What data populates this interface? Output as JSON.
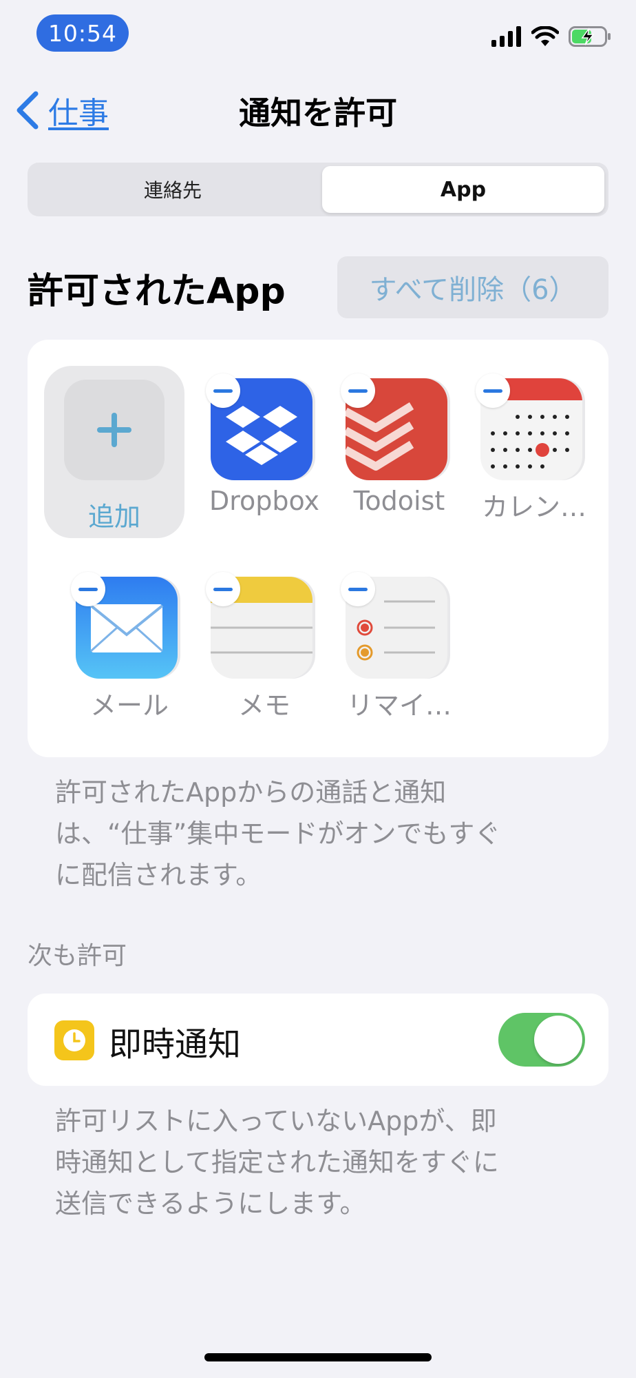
{
  "status_bar": {
    "time": "10:54"
  },
  "nav": {
    "back_label": "仕事",
    "title": "通知を許可"
  },
  "segmented": {
    "options": [
      "連絡先",
      "App"
    ],
    "selected": "App"
  },
  "apps_section": {
    "title": "許可されたApp",
    "remove_all_label": "すべて削除（6）",
    "add_label": "追加",
    "apps": [
      {
        "name": "Dropbox",
        "icon": "dropbox-icon",
        "color": "#2E63E6"
      },
      {
        "name": "Todoist",
        "icon": "todoist-icon",
        "color": "#D8473B"
      },
      {
        "name": "カレン…",
        "icon": "calendar-icon",
        "color": "#E0433C"
      },
      {
        "name": "メール",
        "icon": "mail-icon",
        "color": "#3C8EF0"
      },
      {
        "name": "メモ",
        "icon": "notes-icon",
        "color": "#EFCB3E"
      },
      {
        "name": "リマイ…",
        "icon": "reminders-icon",
        "color": "#E04A3B"
      }
    ],
    "description_lines": [
      "許可されたAppからの通話と通知",
      "は、“仕事”集中モードがオンでもすぐ",
      "に配信されます。"
    ]
  },
  "also_allow": {
    "header": "次も許可",
    "time_sensitive_label": "即時通知",
    "time_sensitive_on": true,
    "description_lines": [
      "許可リストに入っていないAppが、即",
      "時通知として指定された通知をすぐに",
      "送信できるようにします。"
    ]
  },
  "colors": {
    "accent": "#2D7BE5",
    "toggle_on": "#5FC466",
    "background": "#F2F2F7"
  }
}
